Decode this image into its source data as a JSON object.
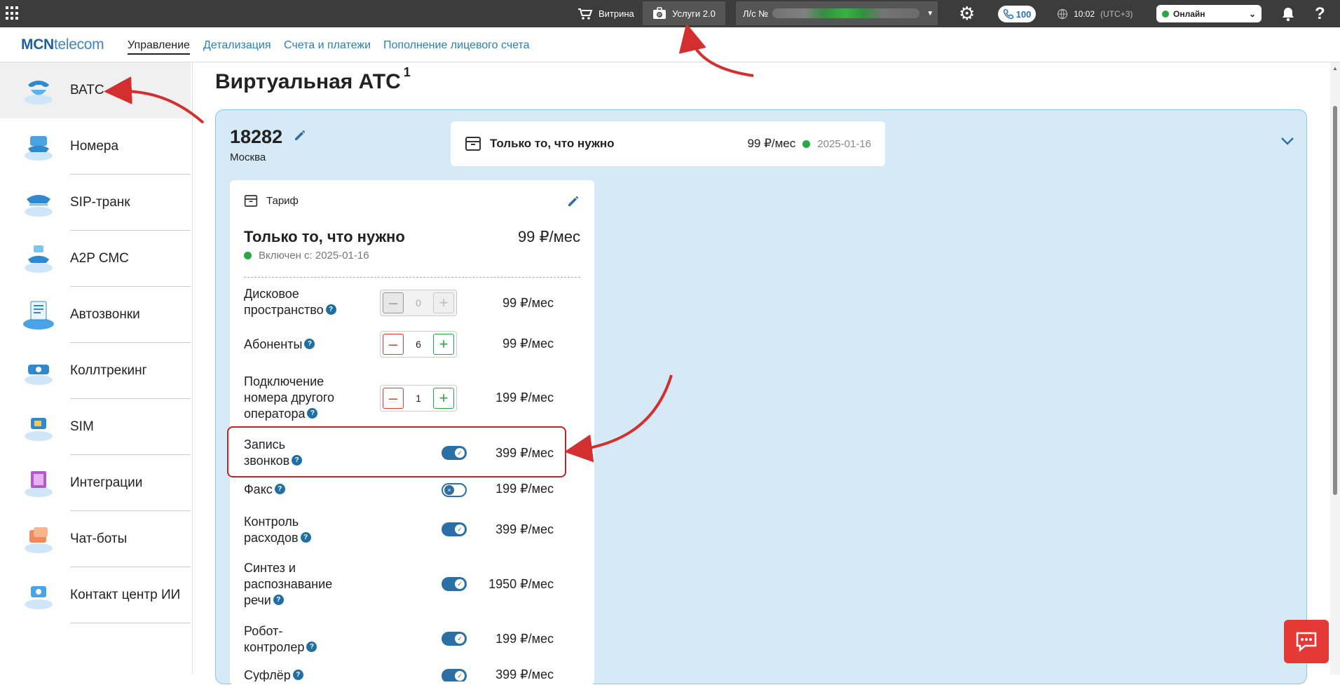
{
  "topbar": {
    "vitrina_label": "Витрина",
    "uslugi_label": "Услуги 2.0",
    "account_label": "Л/с №",
    "calls_count": "100",
    "time": "10:02",
    "timezone": "(UTC+3)",
    "status": "Онлайн"
  },
  "brand": {
    "logo_bold": "MCN",
    "logo_light": "telecom"
  },
  "nav": {
    "items": [
      {
        "label": "Управление",
        "active": true
      },
      {
        "label": "Детализация"
      },
      {
        "label": "Счета и платежи"
      },
      {
        "label": "Пополнение лицевого счета"
      }
    ]
  },
  "sidebar": {
    "items": [
      {
        "label": "ВАТС",
        "icon": "vats-icon",
        "active": true
      },
      {
        "label": "Номера",
        "icon": "numbers-icon"
      },
      {
        "label": "SIP-транк",
        "icon": "sip-trunk-icon"
      },
      {
        "label": "A2P СМС",
        "icon": "sms-icon"
      },
      {
        "label": "Автозвонки",
        "icon": "autocall-icon"
      },
      {
        "label": "Коллтрекинг",
        "icon": "calltracking-icon"
      },
      {
        "label": "SIM",
        "icon": "sim-icon"
      },
      {
        "label": "Интеграции",
        "icon": "integrations-icon"
      },
      {
        "label": "Чат-боты",
        "icon": "chatbots-icon"
      },
      {
        "label": "Контакт центр ИИ",
        "icon": "ai-contact-center-icon"
      }
    ]
  },
  "page": {
    "title": "Виртуальная АТС",
    "title_sup": "1"
  },
  "service": {
    "number": "18282",
    "city": "Москва",
    "summary": {
      "name": "Только то, что нужно",
      "price": "99 ₽/мес",
      "date": "2025-01-16"
    }
  },
  "tariff": {
    "header": "Тариф",
    "name": "Только то, что нужно",
    "price": "99 ₽/мес",
    "since": "Включен с: 2025-01-16",
    "options": [
      {
        "label_lines": [
          "Дисковое",
          "пространство"
        ],
        "type": "stepper",
        "value": "0",
        "disabled": true,
        "price": "99 ₽/мес"
      },
      {
        "label_lines": [
          "Абоненты"
        ],
        "type": "stepper",
        "value": "6",
        "price": "99 ₽/мес"
      },
      {
        "label_lines": [
          "Подключение",
          "номера другого",
          "оператора"
        ],
        "type": "stepper",
        "value": "1",
        "price": "199 ₽/мес"
      },
      {
        "label_lines": [
          "Запись",
          "звонков"
        ],
        "type": "toggle",
        "on": true,
        "price": "399 ₽/мес"
      },
      {
        "label_lines": [
          "Факс"
        ],
        "type": "toggle",
        "on": false,
        "price": "199 ₽/мес"
      },
      {
        "label_lines": [
          "Контроль",
          "расходов"
        ],
        "type": "toggle",
        "on": true,
        "price": "399 ₽/мес"
      },
      {
        "label_lines": [
          "Синтез и",
          "распознавание",
          "речи"
        ],
        "type": "toggle",
        "on": true,
        "price": "1950 ₽/мес"
      },
      {
        "label_lines": [
          "Робот-",
          "контролер"
        ],
        "type": "toggle",
        "on": true,
        "price": "199 ₽/мес"
      },
      {
        "label_lines": [
          "Суфлёр"
        ],
        "type": "toggle",
        "on": true,
        "price": "399 ₽/мес"
      }
    ]
  },
  "colors": {
    "topbar": "#3c3c3c",
    "accent": "#2980b9",
    "panel_bg": "#d5e9f7",
    "highlight": "#c0242c",
    "status_green": "#28a745"
  }
}
